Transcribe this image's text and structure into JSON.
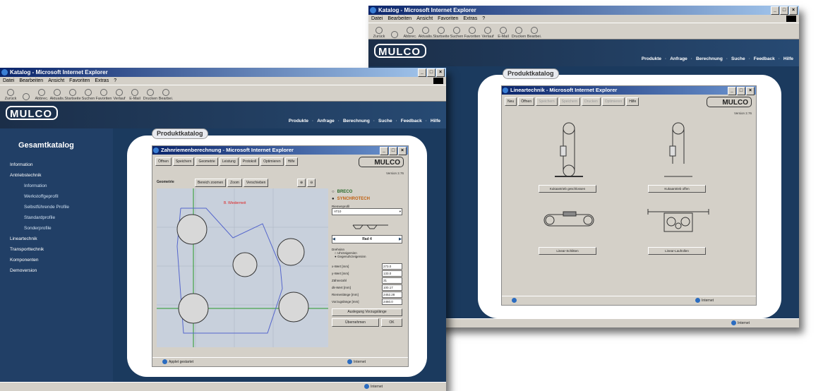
{
  "back_window": {
    "title": "Katalog - Microsoft Internet Explorer",
    "menu": [
      "Datei",
      "Bearbeiten",
      "Ansicht",
      "Favoriten",
      "Extras",
      "?"
    ],
    "toolbar": [
      "Zurück",
      "",
      "Abbrec.",
      "Aktualis.",
      "Startseite",
      "Suchen",
      "Favoriten",
      "Verlauf",
      "E-Mail",
      "Drucken",
      "Bearbei."
    ],
    "nav": [
      "Produkte",
      "Anfrage",
      "Berechnung",
      "Suche",
      "Feedback",
      "Hilfe"
    ],
    "panel_title": "Produktkatalog",
    "inner": {
      "title": "Lineartechnik - Microsoft Internet Explorer",
      "buttons": [
        "Neu",
        "Öffnen",
        "Speichern",
        "Speichern",
        "Drucken",
        "Optimieren",
        "Hilfe"
      ],
      "version": "Version 2.76",
      "products": [
        "Kukaantrieb geschlossen",
        "Kukaantrieb offen",
        "Linear-Schlitten",
        "Linear-Laufrollen"
      ],
      "status": "Internet"
    },
    "status": "Internet"
  },
  "front_window": {
    "title": "Katalog - Microsoft Internet Explorer",
    "menu": [
      "Datei",
      "Bearbeiten",
      "Ansicht",
      "Favoriten",
      "Extras",
      "?"
    ],
    "toolbar": [
      "Zurück",
      "",
      "Abbrec.",
      "Aktualis.",
      "Startseite",
      "Suchen",
      "Favoriten",
      "Verlauf",
      "E-Mail",
      "Drucken",
      "Bearbei."
    ],
    "nav": [
      "Produkte",
      "Anfrage",
      "Berechnung",
      "Suche",
      "Feedback",
      "Hilfe"
    ],
    "sidebar_title": "Gesamtkatalog",
    "sidebar": [
      {
        "label": "Information",
        "level": 0
      },
      {
        "label": "Antriebstechnik",
        "level": 0
      },
      {
        "label": "Information",
        "level": 1
      },
      {
        "label": "Werkstoffgeprofil",
        "level": 1
      },
      {
        "label": "Selbstführende Profile",
        "level": 1
      },
      {
        "label": "Standardprofile",
        "level": 1
      },
      {
        "label": "Sonderprofile",
        "level": 1
      },
      {
        "label": "Lineartechnik",
        "level": 0
      },
      {
        "label": "Transporttechnik",
        "level": 0
      },
      {
        "label": "Komponenten",
        "level": 0
      },
      {
        "label": "Demoversion",
        "level": 0
      }
    ],
    "panel_title": "Produktkatalog",
    "inner": {
      "title": "Zahnriemenberechnung - Microsoft Internet Explorer",
      "buttons": [
        "Öffnen",
        "Speichern",
        "Geometrie",
        "Leistung",
        "Protokoll",
        "Optimieren",
        "Hilfe"
      ],
      "version": "Version 2.76",
      "geometry_label": "Geometrie",
      "geo_buttons": [
        "Bereich zoomen",
        "Zoom",
        "Verschieben"
      ],
      "warning": "B. Wiedermeit",
      "brands": [
        "BRECO",
        "SYNCHROTECH"
      ],
      "profile_label": "Riemenprofil",
      "profile_value": "AT10",
      "rad_label": "Rad 4",
      "direction_label": "Drehsinn",
      "direction_opts": [
        "Uhrzeigersinn",
        "Gegenuhrzeigersinn"
      ],
      "fields": [
        {
          "label": "x-Wert [mm]",
          "value": "273.0"
        },
        {
          "label": "y-Wert [mm]",
          "value": "133.0"
        },
        {
          "label": "Zähnezahl",
          "value": "31"
        },
        {
          "label": "dk-Wert [mm]",
          "value": "100.17"
        },
        {
          "label": "Riemenlänge [mm]",
          "value": "2452.28"
        },
        {
          "label": "Vorzugslänge [mm]",
          "value": "2460.0"
        }
      ],
      "bottom_buttons": [
        "Auslegung Vorzugslänge",
        "Übernehmen",
        "OK"
      ],
      "status_left": "Applet gestartet",
      "status_zone": "Internet"
    },
    "status": "Internet"
  }
}
